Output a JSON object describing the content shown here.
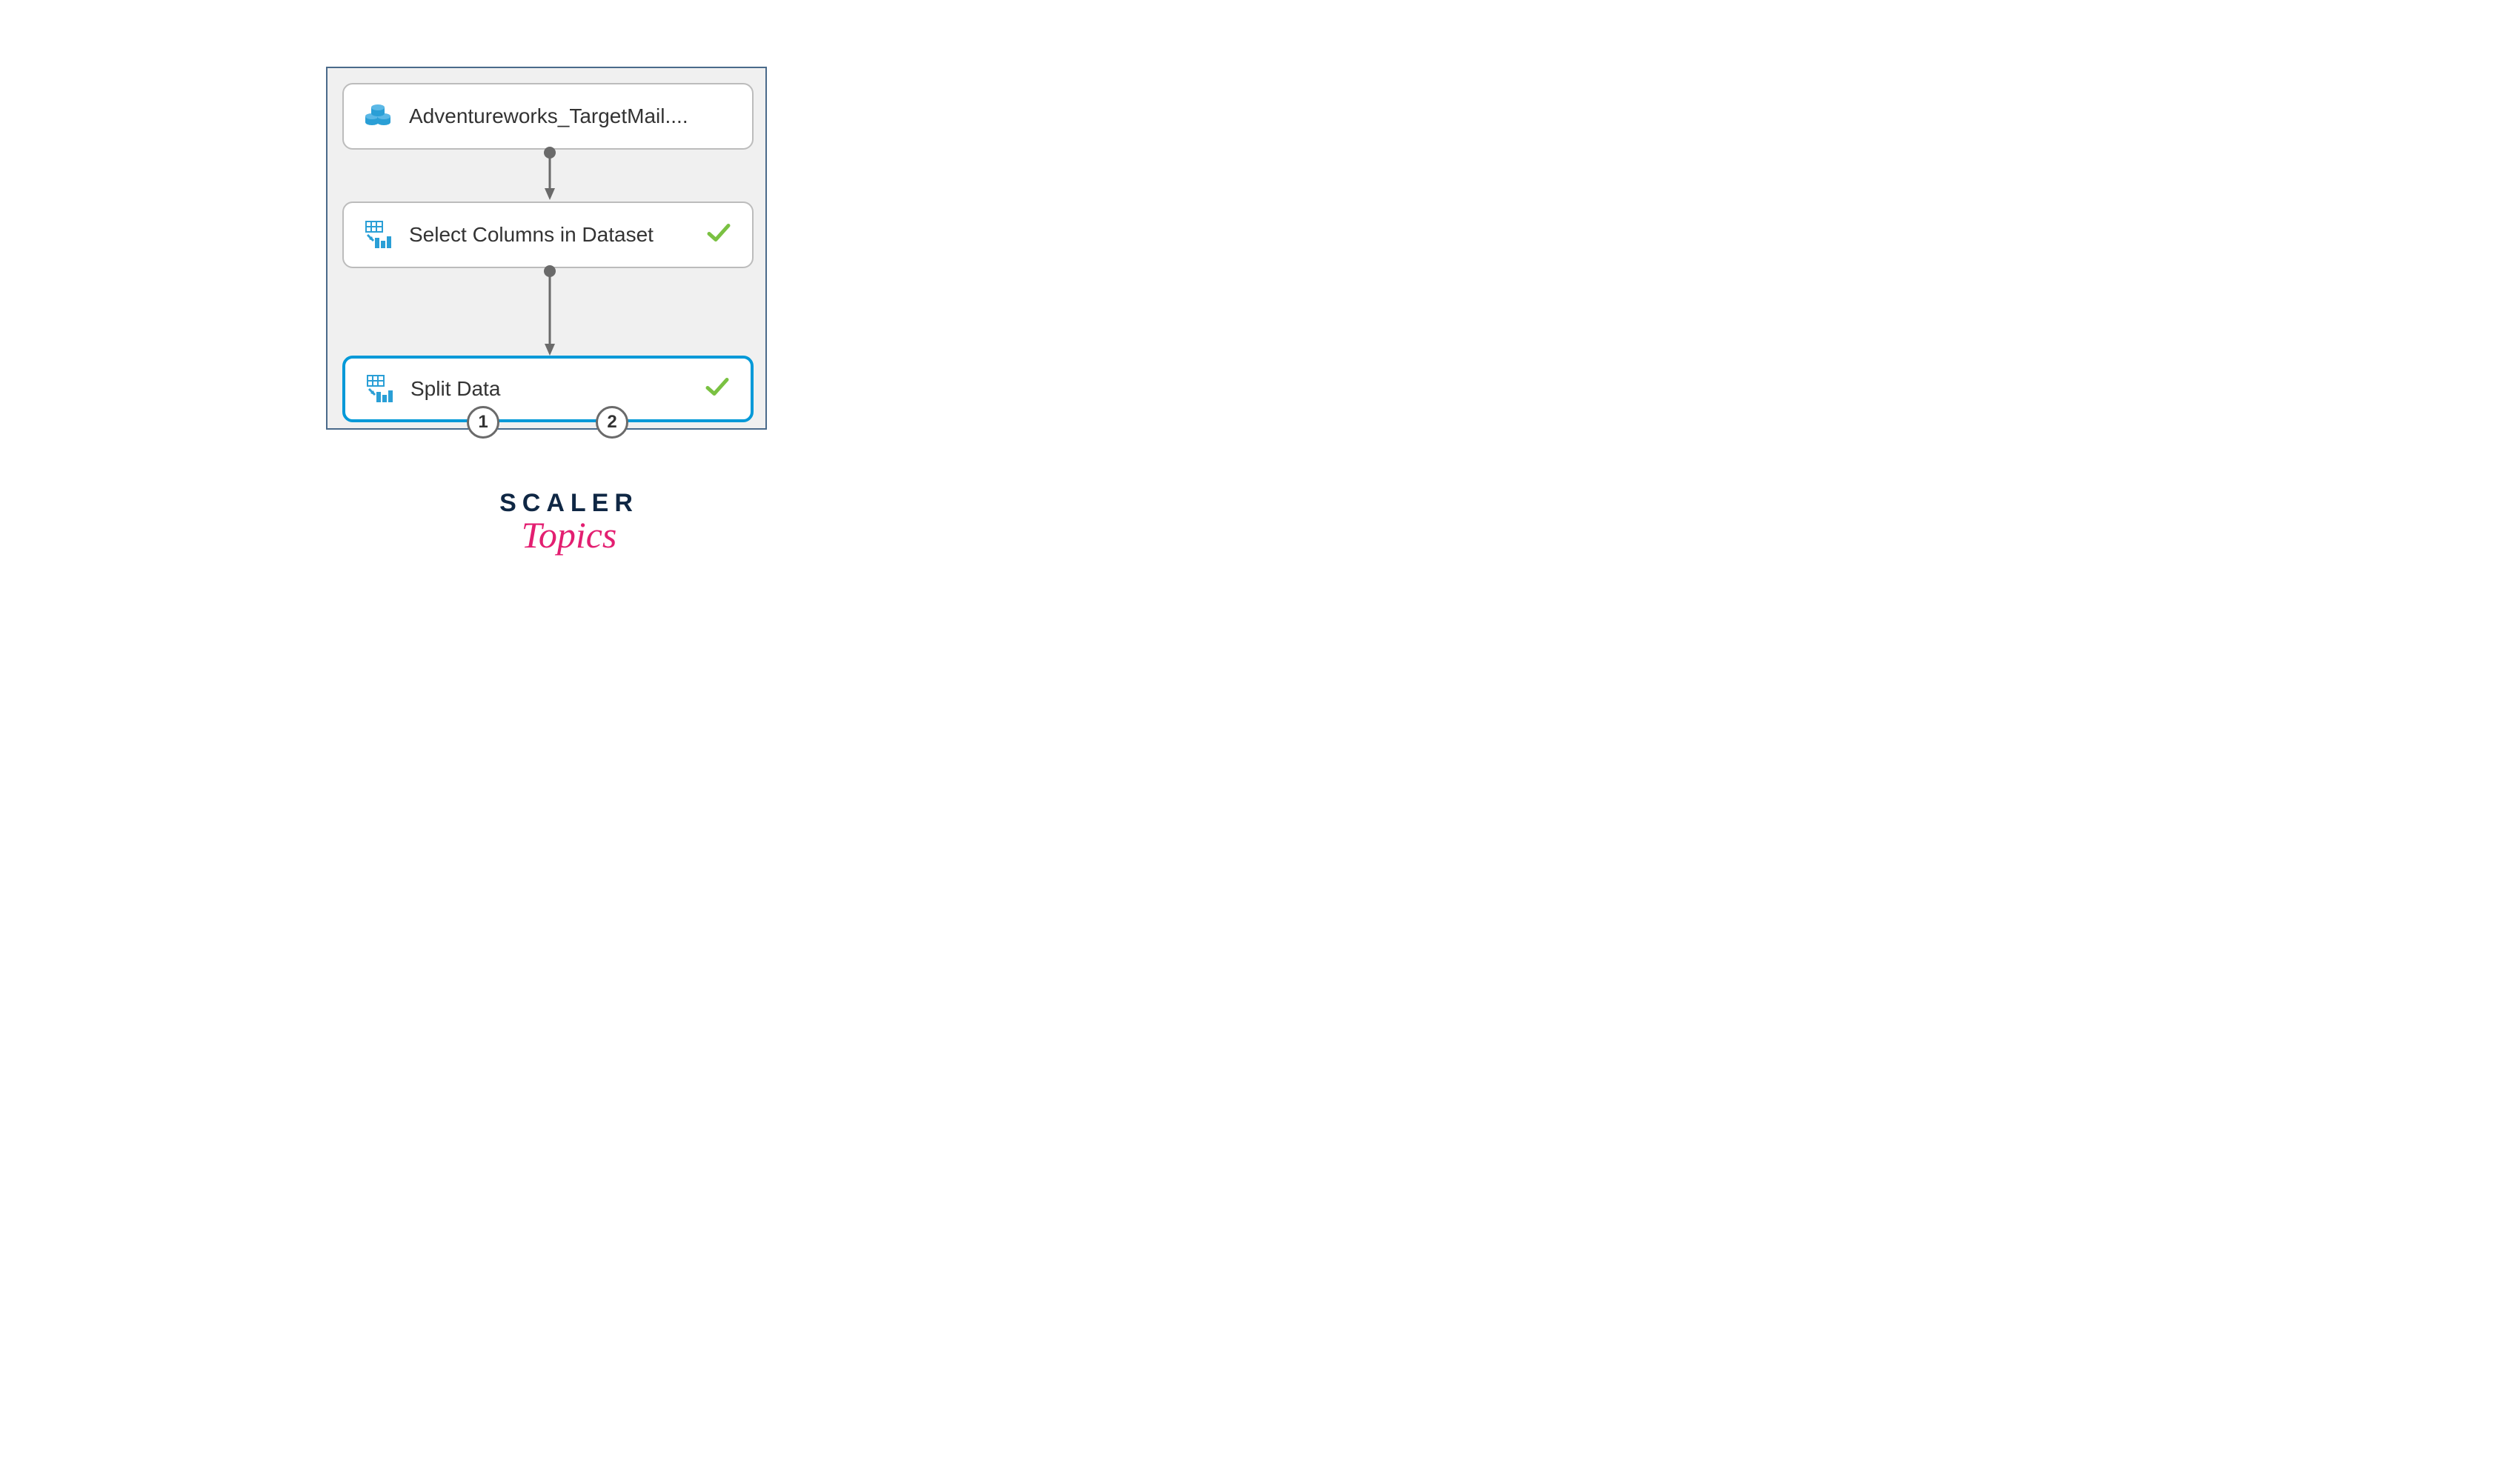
{
  "nodes": {
    "dataset": {
      "label": "Adventureworks_TargetMail...."
    },
    "select": {
      "label": "Select Columns in Dataset"
    },
    "split": {
      "label": "Split Data",
      "output_ports": [
        "1",
        "2"
      ]
    }
  },
  "branding": {
    "line1": "SCALER",
    "line2": "Topics"
  }
}
